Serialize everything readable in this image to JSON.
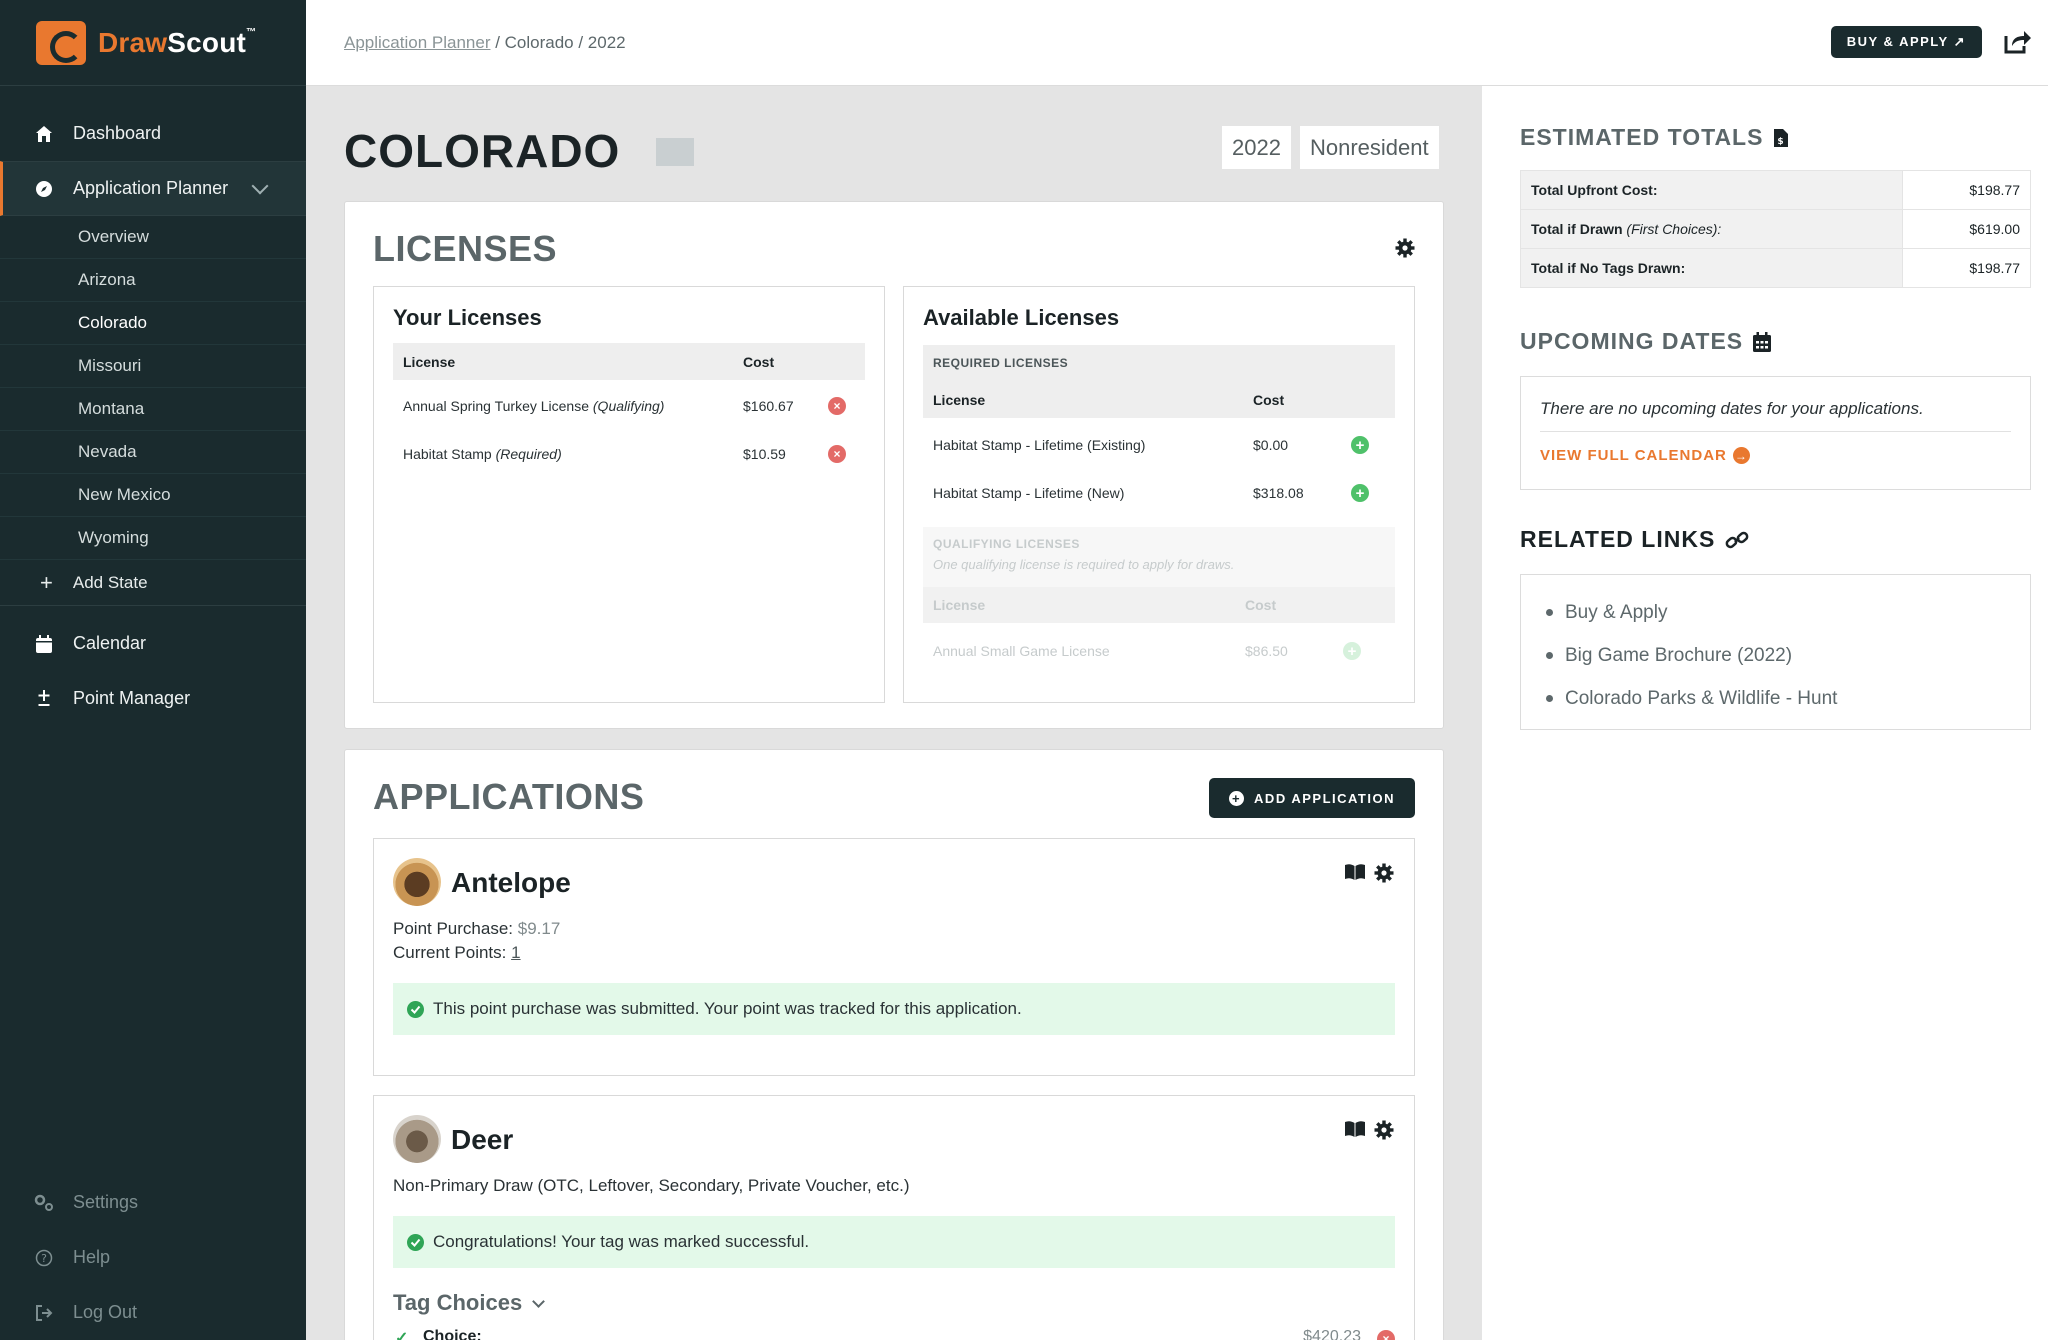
{
  "brand": {
    "draw": "Draw",
    "scout": "Scout",
    "tm": "™"
  },
  "sidebar": {
    "nav": [
      {
        "label": "Dashboard",
        "icon": "home-icon"
      },
      {
        "label": "Application Planner",
        "icon": "compass-icon"
      }
    ],
    "states": [
      "Overview",
      "Arizona",
      "Colorado",
      "Missouri",
      "Montana",
      "Nevada",
      "New Mexico",
      "Wyoming"
    ],
    "current_state": "Colorado",
    "add_state": "Add State",
    "nav2": [
      {
        "label": "Calendar",
        "icon": "calendar-icon"
      },
      {
        "label": "Point Manager",
        "icon": "plus-minus-icon"
      }
    ],
    "bottom": [
      {
        "label": "Settings",
        "icon": "settings-icon"
      },
      {
        "label": "Help",
        "icon": "help-icon"
      },
      {
        "label": "Log Out",
        "icon": "logout-icon"
      }
    ]
  },
  "header": {
    "breadcrumb_link": "Application Planner",
    "breadcrumb_rest": " / Colorado / 2022",
    "buy_apply": "BUY & APPLY ↗"
  },
  "main": {
    "state": "COLORADO",
    "year": "2022",
    "residency": "Nonresident",
    "licenses": {
      "title": "LICENSES",
      "yours": {
        "title": "Your Licenses",
        "col_license": "License",
        "col_cost": "Cost",
        "rows": [
          {
            "name": "Annual Spring Turkey License",
            "note": "(Qualifying)",
            "cost": "$160.67"
          },
          {
            "name": "Habitat Stamp",
            "note": "(Required)",
            "cost": "$10.59"
          }
        ]
      },
      "available": {
        "title": "Available Licenses",
        "required_label": "REQUIRED LICENSES",
        "col_license": "License",
        "col_cost": "Cost",
        "rows": [
          {
            "name": "Habitat Stamp - Lifetime (Existing)",
            "cost": "$0.00"
          },
          {
            "name": "Habitat Stamp - Lifetime (New)",
            "cost": "$318.08"
          }
        ],
        "qualifying_label": "QUALIFYING LICENSES",
        "qualifying_note": "One qualifying license is required to apply for draws.",
        "q_col_license": "License",
        "q_col_cost": "Cost",
        "q_rows": [
          {
            "name": "Annual Small Game License",
            "cost": "$86.50"
          }
        ]
      }
    },
    "applications": {
      "title": "APPLICATIONS",
      "add_button": "ADD APPLICATION",
      "antelope": {
        "species": "Antelope",
        "point_purchase_label": "Point Purchase: ",
        "point_purchase_value": "$9.17",
        "current_points_label": "Current Points: ",
        "current_points_value": "1",
        "message": "This point purchase was submitted. Your point was tracked for this application."
      },
      "deer": {
        "species": "Deer",
        "draw_type": "Non-Primary Draw (OTC, Leftover, Secondary, Private Voucher, etc.)",
        "message": "Congratulations! Your tag was marked successful.",
        "tag_choices": "Tag Choices",
        "choice_label": "Choice:",
        "choice_cost": "$420.23"
      }
    }
  },
  "right": {
    "totals_title": "ESTIMATED TOTALS",
    "totals": [
      {
        "label": "Total Upfront Cost:",
        "note": "",
        "value": "$198.77"
      },
      {
        "label": "Total if Drawn",
        "note": "(First Choices):",
        "value": "$619.00"
      },
      {
        "label": "Total if No Tags Drawn:",
        "note": "",
        "value": "$198.77"
      }
    ],
    "upcoming_title": "UPCOMING DATES",
    "upcoming_msg": "There are no upcoming dates for your applications.",
    "calendar_link": "VIEW FULL CALENDAR",
    "links_title": "RELATED LINKS",
    "links": [
      "Buy & Apply",
      "Big Game Brochure (2022)",
      "Colorado Parks & Wildlife - Hunt"
    ]
  },
  "colors": {
    "accent": "#e9782f",
    "sidebar": "#1a2b2e",
    "success_bg": "#e3f9e9",
    "remove": "#e36a67",
    "add": "#4fc16a"
  }
}
